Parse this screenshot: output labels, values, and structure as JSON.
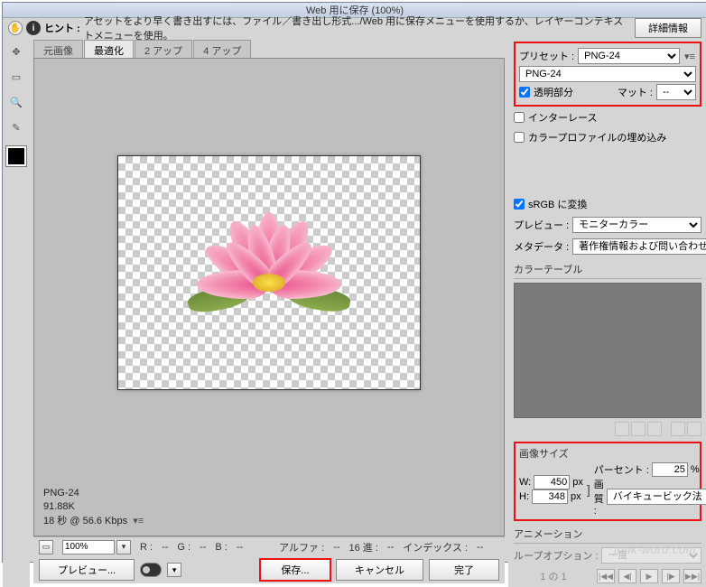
{
  "title": "Web 用に保存 (100%)",
  "hint": {
    "label": "ヒント :",
    "text": "アセットをより早く書き出すには、ファイル／書き出し形式.../Web 用に保存メニューを使用するか、レイヤーコンテキストメニューを使用。",
    "detail_btn": "詳細情報"
  },
  "tabs": {
    "original": "元画像",
    "optimized": "最適化",
    "two_up": "2 アップ",
    "four_up": "4 アップ"
  },
  "preview_info": {
    "format": "PNG-24",
    "size": "91.88K",
    "time": "18 秒 @ 56.6 Kbps"
  },
  "status": {
    "zoom": "100%",
    "r": "R :",
    "r_val": "--",
    "g": "G :",
    "g_val": "--",
    "b": "B :",
    "b_val": "--",
    "alpha": "アルファ :",
    "alpha_val": "--",
    "hex": "16 進 :",
    "hex_val": "--",
    "index": "インデックス :",
    "index_val": "--"
  },
  "footer": {
    "preview": "プレビュー...",
    "save": "保存...",
    "cancel": "キャンセル",
    "done": "完了"
  },
  "side": {
    "preset_label": "プリセット :",
    "preset_value": "PNG-24",
    "format_value": "PNG-24",
    "transparency": "透明部分",
    "matte_label": "マット :",
    "matte_value": "--",
    "interlace": "インターレース",
    "embed_profile": "カラープロファイルの埋め込み",
    "srgb": "sRGB に変換",
    "preview_label": "プレビュー :",
    "preview_value": "モニターカラー",
    "metadata_label": "メタデータ :",
    "metadata_value": "著作権情報および問い合わせ先",
    "colortable_title": "カラーテーブル",
    "imagesize_title": "画像サイズ",
    "w_label": "W:",
    "w_value": "450",
    "px": "px",
    "h_label": "H:",
    "h_value": "348",
    "percent_label": "パーセント :",
    "percent_value": "25",
    "percent_unit": "%",
    "quality_label": "画質 :",
    "quality_value": "バイキュービック法",
    "animation_title": "アニメーション",
    "loop_label": "ループオプション :",
    "loop_value": "一度",
    "frame": "1 の 1"
  },
  "watermark": "junk-word.com"
}
